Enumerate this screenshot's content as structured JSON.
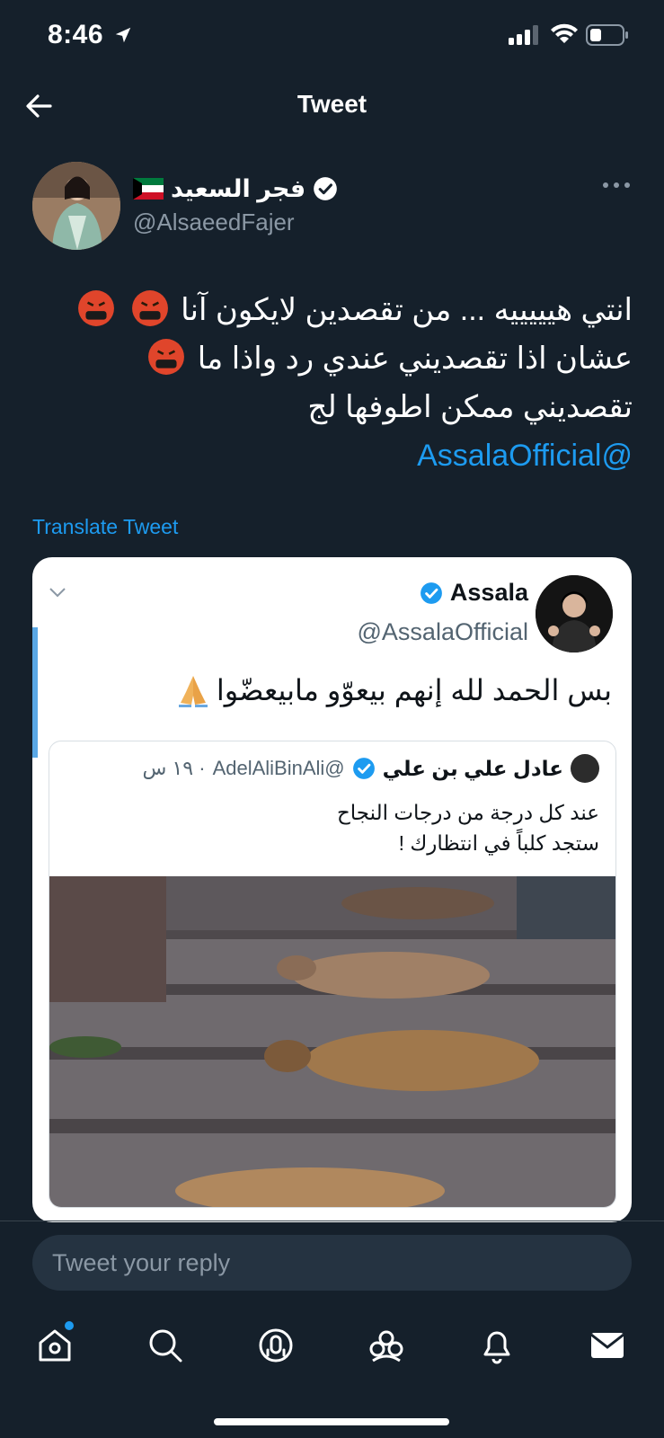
{
  "status_bar": {
    "time": "8:46",
    "icons": [
      "location-arrow-icon",
      "signal-icon",
      "wifi-icon",
      "battery-icon"
    ]
  },
  "nav": {
    "title": "Tweet",
    "back_icon": "back-arrow-icon"
  },
  "tweet": {
    "author": {
      "name": "فجر السعيد",
      "handle": "@AlsaeedFajer",
      "verified": true,
      "flag": "kuwait-flag-icon"
    },
    "text_lines": [
      "انتي هيييييه ... من تقصدين لايكون آنا",
      "عشان اذا تقصديني عندي رد واذا ما",
      "تقصديني ممكن اطوفها لج"
    ],
    "mention": "@AssalaOfficial",
    "translate_label": "Translate Tweet"
  },
  "embedded": {
    "name": "Assala",
    "handle": "@AssalaOfficial",
    "text": "بس الحمد لله إنهم بيعوّو مابيعضّوا",
    "quoted": {
      "name": "عادل علي بن علي",
      "handle": "@AdelAliBinAli",
      "time": "· ١٩ س",
      "text_lines": [
        "عند كل درجة من درجات النجاح",
        "ستجد كلباً في انتظارك !"
      ]
    }
  },
  "reply": {
    "placeholder": "Tweet your reply"
  },
  "tabs": [
    {
      "name": "home",
      "icon": "home-icon"
    },
    {
      "name": "search",
      "icon": "search-icon"
    },
    {
      "name": "spaces",
      "icon": "spaces-icon"
    },
    {
      "name": "communities",
      "icon": "communities-icon"
    },
    {
      "name": "notifications",
      "icon": "bell-icon"
    },
    {
      "name": "messages",
      "icon": "mail-icon"
    }
  ],
  "colors": {
    "background": "#15202b",
    "accent": "#1d9bf0",
    "muted": "#8b98a5",
    "input_bg": "#253341"
  }
}
